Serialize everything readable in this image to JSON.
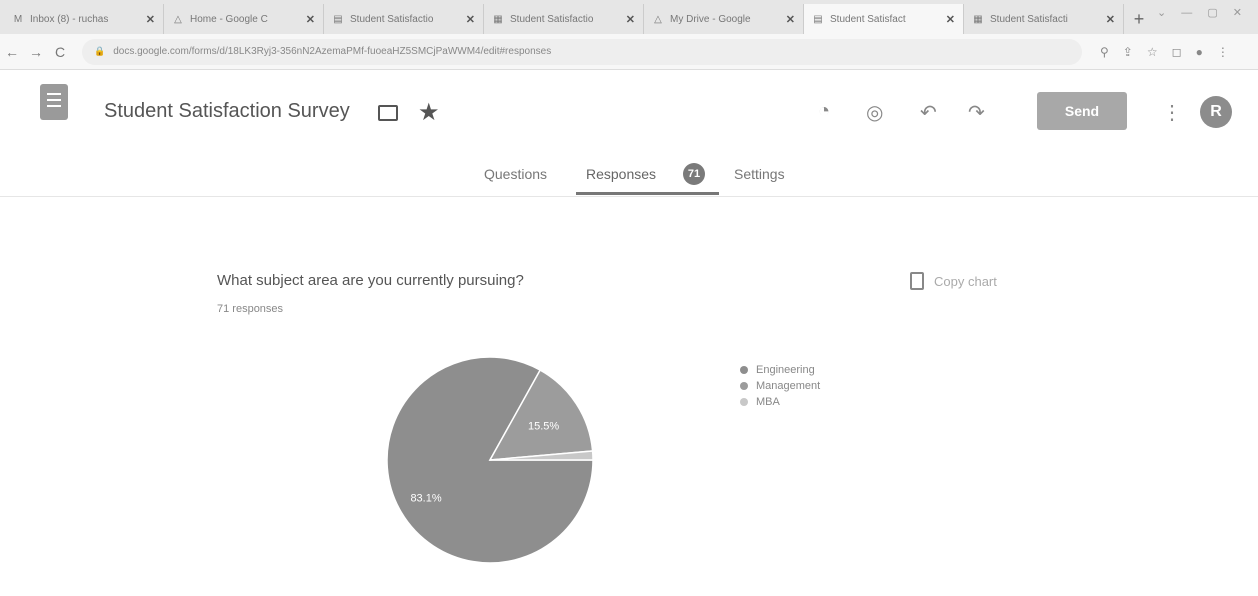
{
  "browser": {
    "tabs": [
      {
        "title": "Inbox (8) - ruchas",
        "icon": "gmail-icon",
        "glyph": "M"
      },
      {
        "title": "Home - Google C",
        "icon": "drive-icon",
        "glyph": "△"
      },
      {
        "title": "Student Satisfactio",
        "icon": "forms-icon",
        "glyph": "▤"
      },
      {
        "title": "Student Satisfactio",
        "icon": "sheets-icon",
        "glyph": "▦"
      },
      {
        "title": "My Drive - Google",
        "icon": "drive-icon",
        "glyph": "△"
      },
      {
        "title": "Student Satisfact",
        "icon": "forms-icon",
        "glyph": "▤"
      },
      {
        "title": "Student Satisfacti",
        "icon": "sheets-icon",
        "glyph": "▦"
      }
    ],
    "active_tab": 5,
    "url": "docs.google.com/forms/d/18LK3Ryj3-356nN2AzemaPMf-fuoeaHZ5SMCjPaWWM4/edit#responses"
  },
  "header": {
    "title": "Student Satisfaction Survey",
    "send_label": "Send",
    "avatar_letter": "R"
  },
  "form_tabs": {
    "questions": "Questions",
    "responses": "Responses",
    "responses_count": "71",
    "settings": "Settings"
  },
  "question": {
    "text": "What subject area are you currently pursuing?",
    "responses_label": "71 responses",
    "copy_chart_label": "Copy chart"
  },
  "chart_data": {
    "type": "pie",
    "categories": [
      "Engineering",
      "Management",
      "MBA"
    ],
    "values": [
      83.1,
      15.5,
      1.4
    ],
    "labels": [
      "83.1%",
      "15.5%",
      ""
    ],
    "colors": [
      "#8e8e8e",
      "#9c9c9c",
      "#c8c8c8"
    ],
    "legend_position": "right"
  }
}
